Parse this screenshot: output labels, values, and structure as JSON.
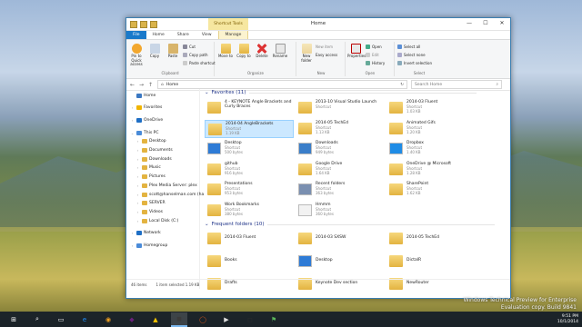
{
  "window": {
    "title": "Home",
    "context_tab": "Shortcut Tools",
    "controls": {
      "minimize": "—",
      "maximize": "☐",
      "close": "✕"
    }
  },
  "ribbon_tabs": [
    "File",
    "Home",
    "Share",
    "View",
    "Manage"
  ],
  "ribbon": {
    "clipboard": {
      "pin": "Pin to Quick access",
      "cut": "Cut",
      "copy_path": "Copy path",
      "paste_shortcut": "Paste shortcut",
      "copy": "Copy",
      "paste": "Paste",
      "label": "Clipboard"
    },
    "organize": {
      "move_to": "Move to",
      "copy_to": "Copy to",
      "delete": "Delete",
      "rename": "Rename",
      "label": "Organize"
    },
    "new": {
      "new_folder": "New folder",
      "new_item": "New item",
      "easy_access": "Easy access",
      "label": "New"
    },
    "open": {
      "properties": "Properties",
      "open": "Open",
      "edit": "Edit",
      "history": "History",
      "label": "Open"
    },
    "select": {
      "select_all": "Select all",
      "select_none": "Select none",
      "invert": "Invert selection",
      "label": "Select"
    }
  },
  "address": {
    "path": "Home",
    "search_placeholder": "Search Home",
    "back": "←",
    "forward": "→",
    "up": "↑",
    "refresh": "↻"
  },
  "nav": [
    {
      "label": "Home",
      "indent": 0,
      "arrow": ""
    },
    {
      "label": "Favorites",
      "indent": 0,
      "arrow": "›"
    },
    {
      "label": "OneDrive",
      "indent": 0,
      "arrow": "›"
    },
    {
      "label": "This PC",
      "indent": 0,
      "arrow": "⌄"
    },
    {
      "label": "Desktop",
      "indent": 1,
      "arrow": "›"
    },
    {
      "label": "Documents",
      "indent": 1,
      "arrow": "›"
    },
    {
      "label": "Downloads",
      "indent": 1,
      "arrow": "›"
    },
    {
      "label": "Music",
      "indent": 1,
      "arrow": "›"
    },
    {
      "label": "Pictures",
      "indent": 1,
      "arrow": "›"
    },
    {
      "label": "Plex Media Server: plex",
      "indent": 1,
      "arrow": "›"
    },
    {
      "label": "scott@hanselman.com (ha",
      "indent": 1,
      "arrow": "›"
    },
    {
      "label": "SERVER",
      "indent": 1,
      "arrow": "›"
    },
    {
      "label": "Videos",
      "indent": 1,
      "arrow": "›"
    },
    {
      "label": "Local Disk (C:)",
      "indent": 1,
      "arrow": "›"
    },
    {
      "label": "Network",
      "indent": 0,
      "arrow": "›"
    },
    {
      "label": "Homegroup",
      "indent": 0,
      "arrow": "›"
    }
  ],
  "favorites_header": "Favorites (11)",
  "frequent_header": "Frequent folders (10)",
  "favorites": [
    {
      "name": "4 - KEYNOTE Angle Brackets and Curly Braces",
      "type": "",
      "size": "",
      "icon": "folder",
      "col": 0,
      "row": 0
    },
    {
      "name": "2013-10 Visual Studio Launch",
      "type": "Shortcut",
      "size": "",
      "icon": "folder",
      "col": 1,
      "row": 0
    },
    {
      "name": "2014-03 Fluent",
      "type": "Shortcut",
      "size": "1.03 KB",
      "icon": "folder",
      "col": 2,
      "row": 0
    },
    {
      "name": "2014-04 AngleBrackets",
      "type": "Shortcut",
      "size": "1.19 KB",
      "icon": "folder",
      "col": 0,
      "row": 1
    },
    {
      "name": "2014-05 TechEd",
      "type": "Shortcut",
      "size": "1.13 KB",
      "icon": "folder",
      "col": 1,
      "row": 1
    },
    {
      "name": "Animated Gifs",
      "type": "Shortcut",
      "size": "1.20 KB",
      "icon": "folder",
      "col": 2,
      "row": 1
    },
    {
      "name": "Desktop",
      "type": "Shortcut",
      "size": "500 bytes",
      "icon": "desktop",
      "col": 0,
      "row": 2
    },
    {
      "name": "Downloads",
      "type": "Shortcut",
      "size": "949 bytes",
      "icon": "download",
      "col": 1,
      "row": 2
    },
    {
      "name": "Dropbox",
      "type": "Shortcut",
      "size": "1.40 KB",
      "icon": "dropbox",
      "col": 2,
      "row": 2
    },
    {
      "name": "github",
      "type": "Shortcut",
      "size": "916 bytes",
      "icon": "folder",
      "col": 0,
      "row": 3
    },
    {
      "name": "Google Drive",
      "type": "Shortcut",
      "size": "1.64 KB",
      "icon": "folder",
      "col": 1,
      "row": 3
    },
    {
      "name": "OneDrive @ Microsoft",
      "type": "Shortcut",
      "size": "1.28 KB",
      "icon": "folder",
      "col": 2,
      "row": 3
    },
    {
      "name": "Presentations",
      "type": "Shortcut",
      "size": "953 bytes",
      "icon": "folder",
      "col": 0,
      "row": 4
    },
    {
      "name": "Recent folders",
      "type": "Shortcut",
      "size": "363 bytes",
      "icon": "recent",
      "col": 1,
      "row": 4
    },
    {
      "name": "SharePoint",
      "type": "Shortcut",
      "size": "1.62 KB",
      "icon": "folder",
      "col": 2,
      "row": 4
    },
    {
      "name": "Work Bookmarks",
      "type": "Shortcut",
      "size": "380 bytes",
      "icon": "folder",
      "col": 0,
      "row": 5
    },
    {
      "name": "Hmmm",
      "type": "Shortcut",
      "size": "360 bytes",
      "icon": "file",
      "col": 1,
      "row": 5
    }
  ],
  "frequent": [
    {
      "name": "2014-03 Fluent",
      "icon": "folder",
      "col": 0,
      "row": 0
    },
    {
      "name": "2014-03 SXSW",
      "icon": "folder",
      "col": 1,
      "row": 0
    },
    {
      "name": "2014-05 TechEd",
      "icon": "folder",
      "col": 2,
      "row": 0
    },
    {
      "name": "Books",
      "icon": "folder",
      "col": 0,
      "row": 1
    },
    {
      "name": "Desktop",
      "icon": "desktop",
      "col": 1,
      "row": 1
    },
    {
      "name": "DictaIR",
      "icon": "folder",
      "col": 2,
      "row": 1
    },
    {
      "name": "Drafts",
      "icon": "folder",
      "col": 0,
      "row": 2
    },
    {
      "name": "Keynote Dev section",
      "icon": "folder",
      "col": 1,
      "row": 2
    },
    {
      "name": "NewRouter",
      "icon": "folder",
      "col": 2,
      "row": 2
    }
  ],
  "status": {
    "count": "46 items",
    "selected": "1 item selected  1.19 KB"
  },
  "watermark": {
    "line1": "Windows Technical Preview for Enterprise",
    "line2": "Evaluation copy. Build 9841"
  },
  "clock": {
    "time": "9:51 PM",
    "date": "10/1/2014"
  },
  "taskbar": [
    "⊞",
    "⌕",
    "▭",
    "e",
    "◉",
    "◆",
    "▲",
    "◼",
    "◯",
    "▶",
    "◻",
    "⚑"
  ],
  "colors": {
    "accent": "#1979ca",
    "selection": "#cce8ff",
    "folder": "#e8bf55"
  }
}
